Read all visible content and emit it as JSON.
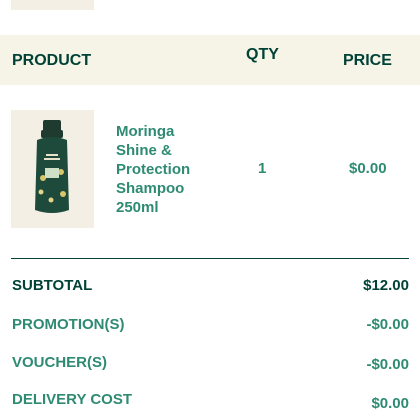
{
  "table_header": {
    "product": "PRODUCT",
    "qty": "QTY",
    "price": "PRICE"
  },
  "item": {
    "name": "Moringa Shine & Protection Shampoo 250ml",
    "qty": "1",
    "price": "$0.00",
    "image_icon": "shampoo-bottle-icon"
  },
  "summary": {
    "subtotal_label": "SUBTOTAL",
    "subtotal_value": "$12.00",
    "promotions_label": "PROMOTION(S)",
    "promotions_value": "-$0.00",
    "vouchers_label": "VOUCHER(S)",
    "vouchers_value": "-$0.00",
    "delivery_label": "DELIVERY COST",
    "delivery_value": "$0.00"
  },
  "colors": {
    "dark_green": "#004236",
    "accent_green": "#2e8b72",
    "cream": "#f6f3e7"
  }
}
